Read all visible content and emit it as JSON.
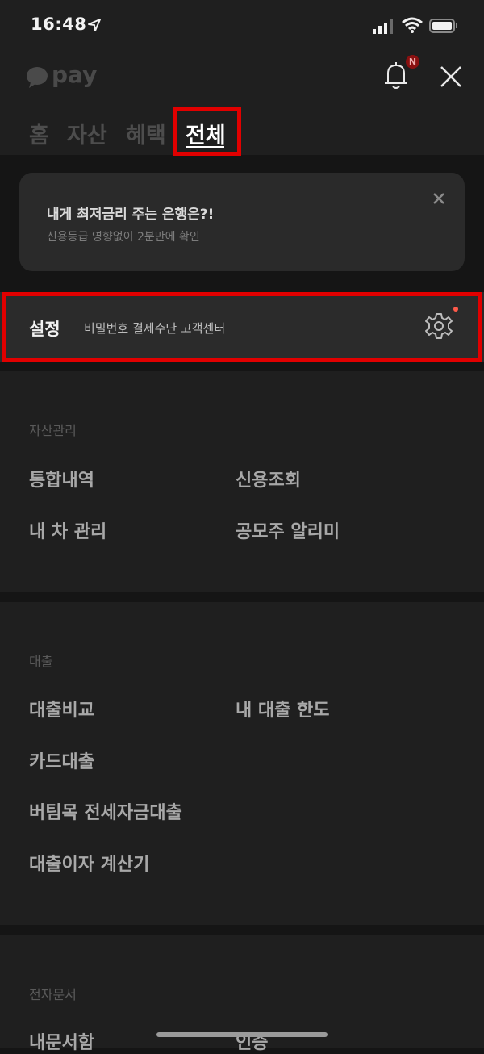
{
  "status_bar": {
    "time": "16:48",
    "icons": [
      "location-arrow-icon",
      "signal-icon",
      "wifi-icon",
      "battery-icon"
    ]
  },
  "header": {
    "logo_text": "pay",
    "notification_badge": "N",
    "tabs": [
      {
        "label": "홈",
        "active": false
      },
      {
        "label": "자산",
        "active": false
      },
      {
        "label": "혜택",
        "active": false
      },
      {
        "label": "전체",
        "active": true
      }
    ]
  },
  "banner": {
    "title": "내게 최저금리 주는 은행은?!",
    "subtitle": "신용등급 영향없이 2분만에 확인"
  },
  "settings": {
    "label": "설정",
    "subtitle": "비밀번호 결제수단 고객센터"
  },
  "sections": [
    {
      "title": "자산관리",
      "items": [
        "통합내역",
        "신용조회",
        "내 차 관리",
        "공모주 알리미"
      ]
    },
    {
      "title": "대출",
      "items": [
        "대출비교",
        "내 대출 한도",
        "카드대출",
        "버팀목 전세자금대출",
        "대출이자 계산기"
      ]
    },
    {
      "title": "전자문서",
      "items": [
        "내문서함",
        "인증"
      ]
    }
  ],
  "colors": {
    "background": "#151515",
    "panel": "#1f1f1f",
    "highlight": "#e10000",
    "dot": "#ff5a4a"
  }
}
